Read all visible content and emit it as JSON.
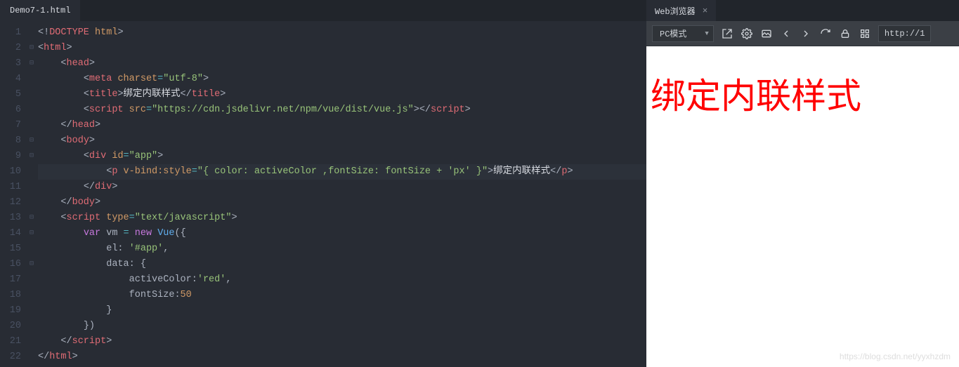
{
  "editor": {
    "tab_label": "Demo7-1.html",
    "lines": [
      {
        "n": 1,
        "fold": "",
        "html": "<span class='c-pun'>&lt;!</span><span class='c-tag'>DOCTYPE</span> <span class='c-attr'>html</span><span class='c-pun'>&gt;</span>"
      },
      {
        "n": 2,
        "fold": "⊟",
        "html": "<span class='c-pun'>&lt;</span><span class='c-tag'>html</span><span class='c-pun'>&gt;</span>"
      },
      {
        "n": 3,
        "fold": "⊟",
        "html": "    <span class='c-pun'>&lt;</span><span class='c-tag'>head</span><span class='c-pun'>&gt;</span>"
      },
      {
        "n": 4,
        "fold": "",
        "html": "        <span class='c-pun'>&lt;</span><span class='c-tag'>meta</span> <span class='c-attr'>charset</span><span class='c-eq'>=</span><span class='c-str'>\"utf-8\"</span><span class='c-pun'>&gt;</span>"
      },
      {
        "n": 5,
        "fold": "",
        "html": "        <span class='c-pun'>&lt;</span><span class='c-tag'>title</span><span class='c-pun'>&gt;</span><span class='c-cj'>绑定内联样式</span><span class='c-pun'>&lt;/</span><span class='c-tag'>title</span><span class='c-pun'>&gt;</span>"
      },
      {
        "n": 6,
        "fold": "",
        "html": "        <span class='c-pun'>&lt;</span><span class='c-tag'>script</span> <span class='c-attr'>src</span><span class='c-eq'>=</span><span class='c-str'>\"https://cdn.jsdelivr.net/npm/vue/dist/vue.js\"</span><span class='c-pun'>&gt;&lt;/</span><span class='c-tag'>script</span><span class='c-pun'>&gt;</span>"
      },
      {
        "n": 7,
        "fold": "",
        "html": "    <span class='c-pun'>&lt;/</span><span class='c-tag'>head</span><span class='c-pun'>&gt;</span>"
      },
      {
        "n": 8,
        "fold": "⊟",
        "html": "    <span class='c-pun'>&lt;</span><span class='c-tag'>body</span><span class='c-pun'>&gt;</span>"
      },
      {
        "n": 9,
        "fold": "⊟",
        "html": "        <span class='c-pun'>&lt;</span><span class='c-tag'>div</span> <span class='c-attr'>id</span><span class='c-eq'>=</span><span class='c-str'>\"app\"</span><span class='c-pun'>&gt;</span>"
      },
      {
        "n": 10,
        "fold": "",
        "hl": true,
        "html": "            <span class='c-pun'>&lt;</span><span class='c-tag'>p</span> <span class='c-attr'>v-bind:style</span><span class='c-eq'>=</span><span class='c-str'>\"{ color: activeColor ,fontSize: fontSize + 'px' }\"</span><span class='c-pun'>&gt;</span><span class='c-cj'>绑定内联样式</span><span class='c-pun'>&lt;/</span><span class='c-tag'>p</span><span class='c-pun'>&gt;</span>"
      },
      {
        "n": 11,
        "fold": "",
        "html": "        <span class='c-pun'>&lt;/</span><span class='c-tag'>div</span><span class='c-pun'>&gt;</span>"
      },
      {
        "n": 12,
        "fold": "",
        "html": "    <span class='c-pun'>&lt;/</span><span class='c-tag'>body</span><span class='c-pun'>&gt;</span>"
      },
      {
        "n": 13,
        "fold": "⊟",
        "html": "    <span class='c-pun'>&lt;</span><span class='c-tag'>script</span> <span class='c-attr'>type</span><span class='c-eq'>=</span><span class='c-str'>\"text/javascript\"</span><span class='c-pun'>&gt;</span>"
      },
      {
        "n": 14,
        "fold": "⊟",
        "html": "        <span class='c-key'>var</span> <span class='c-txt'>vm</span> <span class='c-eq'>=</span> <span class='c-key'>new</span> <span class='c-fn'>Vue</span><span class='c-pun'>({</span>"
      },
      {
        "n": 15,
        "fold": "",
        "html": "            <span class='c-txt'>el</span><span class='c-pun'>:</span> <span class='c-str'>'#app'</span><span class='c-pun'>,</span>"
      },
      {
        "n": 16,
        "fold": "⊟",
        "html": "            <span class='c-txt'>data</span><span class='c-pun'>:</span> <span class='c-pun'>{</span>"
      },
      {
        "n": 17,
        "fold": "",
        "html": "                <span class='c-txt'>activeColor</span><span class='c-pun'>:</span><span class='c-str'>'red'</span><span class='c-pun'>,</span>"
      },
      {
        "n": 18,
        "fold": "",
        "html": "                <span class='c-txt'>fontSize</span><span class='c-pun'>:</span><span class='c-attr'>50</span>"
      },
      {
        "n": 19,
        "fold": "",
        "html": "            <span class='c-pun'>}</span>"
      },
      {
        "n": 20,
        "fold": "",
        "html": "        <span class='c-pun'>})</span>"
      },
      {
        "n": 21,
        "fold": "",
        "html": "    <span class='c-pun'>&lt;/</span><span class='c-tag'>script</span><span class='c-pun'>&gt;</span>"
      },
      {
        "n": 22,
        "fold": "",
        "html": "<span class='c-pun'>&lt;/</span><span class='c-tag'>html</span><span class='c-pun'>&gt;</span>"
      }
    ]
  },
  "browser": {
    "tab_label": "Web浏览器",
    "mode_label": "PC模式",
    "url_value": "http://1",
    "output_text": "绑定内联样式",
    "watermark": "https://blog.csdn.net/yyxhzdm"
  }
}
